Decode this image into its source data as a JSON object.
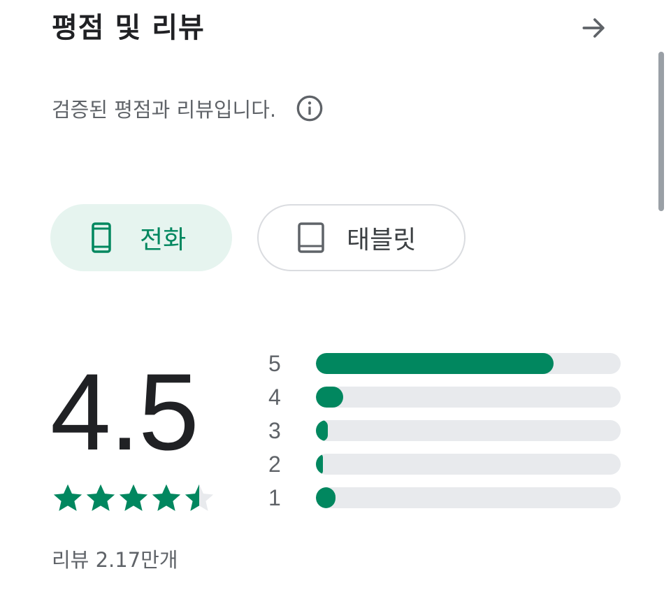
{
  "header": {
    "title": "평점 및 리뷰",
    "arrow_icon": "arrow-right-icon"
  },
  "subtitle": {
    "text": "검증된 평점과 리뷰입니다.",
    "info_icon": "info-icon"
  },
  "device_tabs": [
    {
      "label": "전화",
      "icon": "phone-icon",
      "selected": true
    },
    {
      "label": "태블릿",
      "icon": "tablet-icon",
      "selected": false
    }
  ],
  "rating": {
    "score": "4.5",
    "stars": 4.5,
    "review_count": "리뷰 2.17만개",
    "distribution": [
      {
        "label": "5",
        "fraction": 0.78
      },
      {
        "label": "4",
        "fraction": 0.09
      },
      {
        "label": "3",
        "fraction": 0.04
      },
      {
        "label": "2",
        "fraction": 0.02
      },
      {
        "label": "1",
        "fraction": 0.065
      }
    ]
  },
  "colors": {
    "accent": "#01875f",
    "chip_selected_bg": "#e6f4ef",
    "track": "#e8eaed",
    "text_secondary": "#5f6368"
  }
}
